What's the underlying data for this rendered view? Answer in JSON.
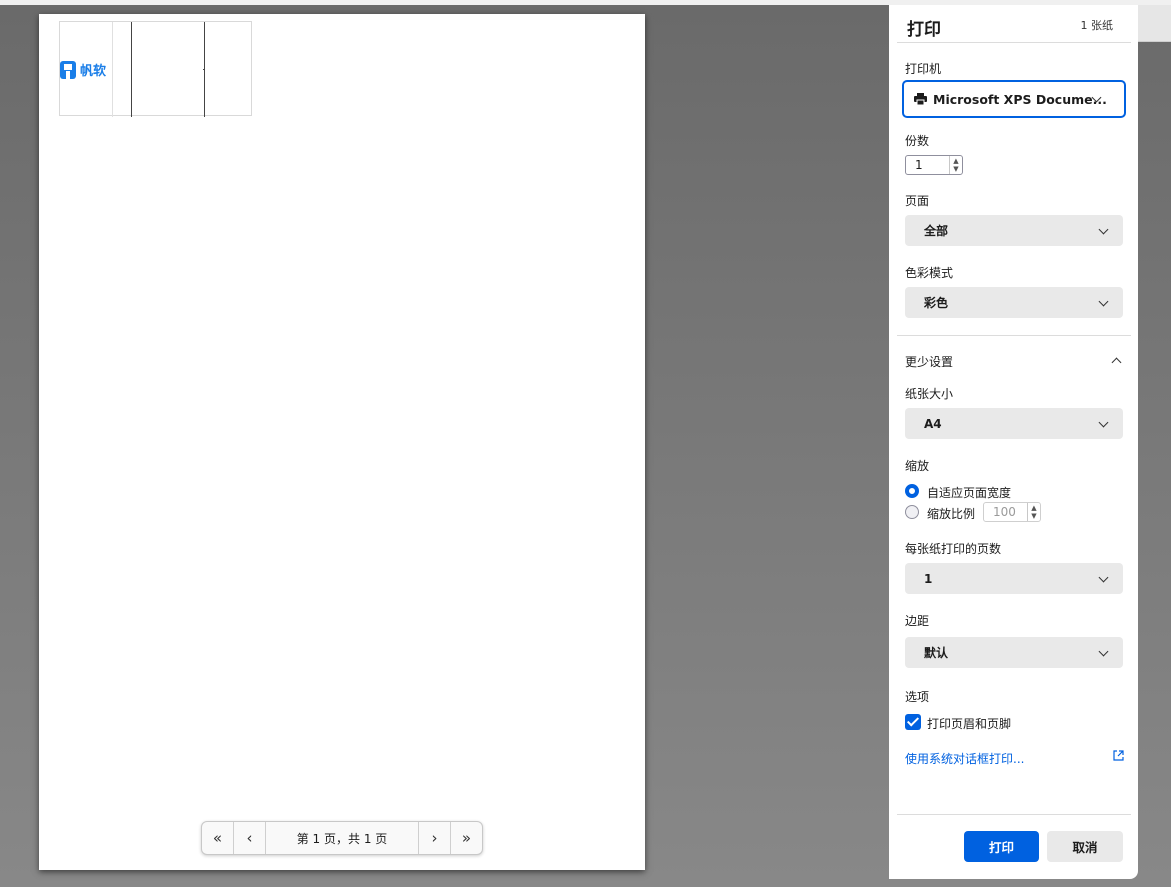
{
  "panel": {
    "title": "打印",
    "sheet_count": "1 张纸",
    "printer_label": "打印机",
    "printer_value": "Microsoft XPS Docume...",
    "copies_label": "份数",
    "copies_value": "1",
    "pages_label": "页面",
    "pages_value": "全部",
    "color_label": "色彩模式",
    "color_value": "彩色",
    "more_settings": "更少设置",
    "paper_label": "纸张大小",
    "paper_value": "A4",
    "scale_label": "缩放",
    "scale_fit_label": "自适应页面宽度",
    "scale_custom_label": "缩放比例",
    "scale_value": "100",
    "pps_label": "每张纸打印的页数",
    "pps_value": "1",
    "margins_label": "边距",
    "margins_value": "默认",
    "options_label": "选项",
    "headers_label": "打印页眉和页脚",
    "system_dialog_link": "使用系统对话框打印...",
    "print_button": "打印",
    "cancel_button": "取消"
  },
  "preview": {
    "logo_text": "帆软",
    "pager_text": "第 1 页，共 1 页"
  },
  "colors": {
    "accent": "#0061e0",
    "logo": "#1a7ee8"
  }
}
